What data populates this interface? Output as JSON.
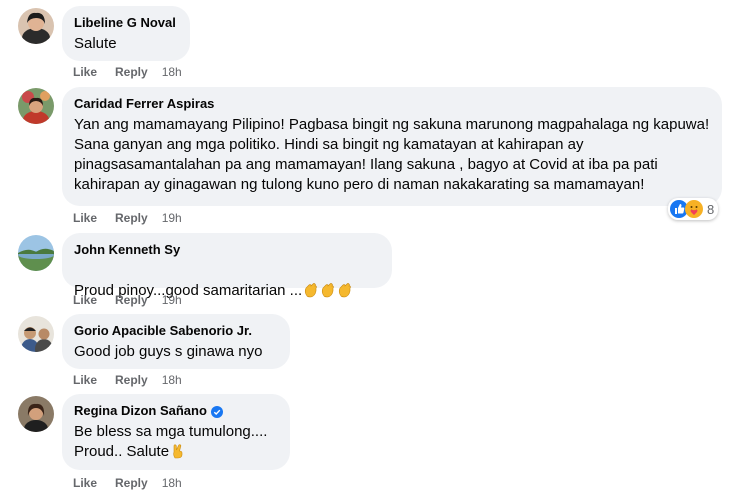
{
  "actions": {
    "like": "Like",
    "reply": "Reply"
  },
  "colors": {
    "bubble": "#f0f2f5",
    "meta": "#65676b",
    "like_blue": "#1877f2",
    "verified": "#1877f2"
  },
  "comments": [
    {
      "author": "Libeline G Noval",
      "text": "Salute",
      "time": "18h",
      "avatar_icon": "profile-photo"
    },
    {
      "author": "Caridad Ferrer Aspiras",
      "text": "Yan ang mamamayang Pilipino! Pagbasa bingit ng sakuna marunong magpahalaga ng kapuwa! Sana ganyan ang mga politiko. Hindi sa bingit ng kamatayan at kahirapan ay pinagsasamantalahan pa ang mamamayan! Ilang sakuna , bagyo at Covid at iba pa pati kahirapan ay ginagawan ng tulong kuno pero di naman nakakarating sa mamamayan!",
      "time": "19h",
      "avatar_icon": "profile-photo",
      "reactions": {
        "icons": [
          "like-reaction-icon",
          "care-reaction-icon"
        ],
        "count": "8"
      }
    },
    {
      "author": "John Kenneth Sy",
      "text": "Proud pinoy...good samaritarian ...",
      "emoji": [
        "clapping-hands-emoji",
        "clapping-hands-emoji",
        "clapping-hands-emoji"
      ],
      "time": "19h",
      "avatar_icon": "profile-photo"
    },
    {
      "author": "Gorio Apacible Sabenorio Jr.",
      "text": "Good job guys s ginawa nyo",
      "time": "18h",
      "avatar_icon": "profile-photo"
    },
    {
      "author": "Regina Dizon Sañano",
      "verified": true,
      "text_line1": "Be bless sa mga tumulong....",
      "text_line2": "Proud.. Salute",
      "emoji": [
        "victory-hand-emoji"
      ],
      "time": "18h",
      "avatar_icon": "profile-photo"
    }
  ]
}
